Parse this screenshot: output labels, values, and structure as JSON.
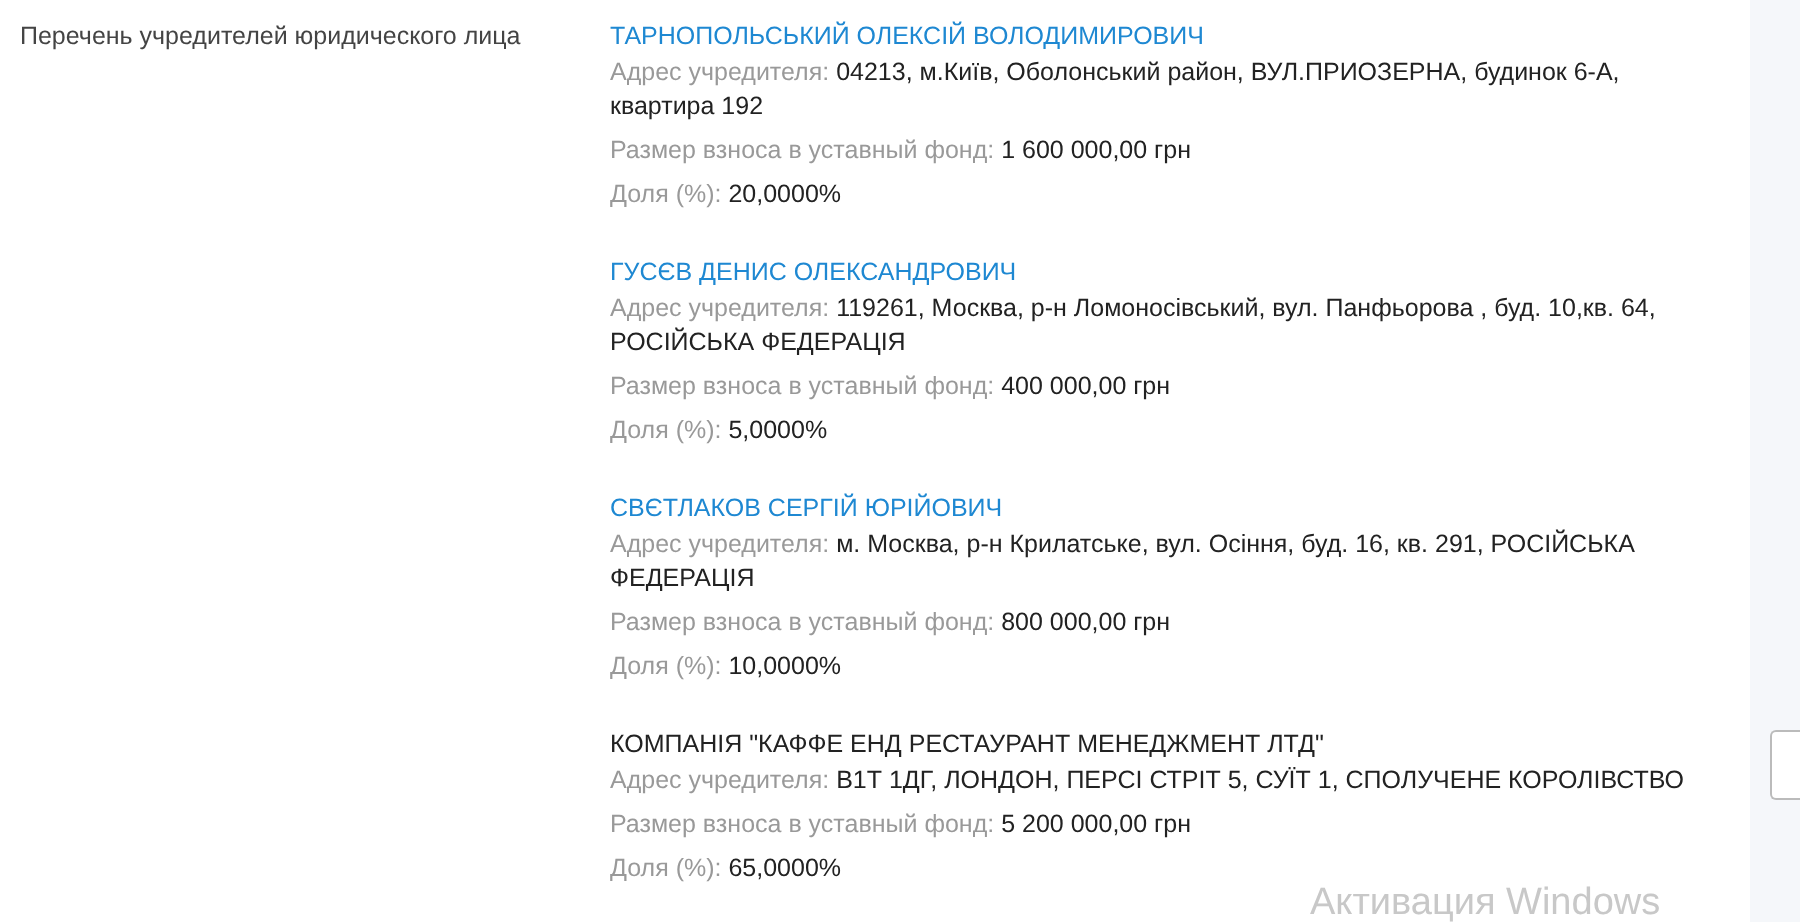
{
  "section_label": "Перечень учредителей юридического лица",
  "founders": [
    {
      "name": "ТАРНОПОЛЬСЬКИЙ ОЛЕКСІЙ ВОЛОДИМИРОВИЧ",
      "link": true,
      "address_label": "Адрес учредителя:",
      "address": "04213, м.Київ, Оболонський район, ВУЛ.ПРИОЗЕРНА, будинок 6-А, квартира 192",
      "contribution_label": "Размер взноса в уставный фонд:",
      "contribution": "1 600 000,00 грн",
      "share_label": "Доля (%):",
      "share": "20,0000%"
    },
    {
      "name": "ГУСЄВ ДЕНИС ОЛЕКСАНДРОВИЧ",
      "link": true,
      "address_label": "Адрес учредителя:",
      "address": "119261, Москва, р-н Ломоносівський, вул. Панфьорова , буд. 10,кв. 64, РОСІЙСЬКА ФЕДЕРАЦІЯ",
      "contribution_label": "Размер взноса в уставный фонд:",
      "contribution": "400 000,00 грн",
      "share_label": "Доля (%):",
      "share": "5,0000%"
    },
    {
      "name": "СВЄТЛАКОВ СЕРГІЙ ЮРІЙОВИЧ",
      "link": true,
      "address_label": "Адрес учредителя:",
      "address": "м. Москва, р-н Крилатське, вул. Осіння, буд. 16, кв. 291, РОСІЙСЬКА ФЕДЕРАЦІЯ",
      "contribution_label": "Размер взноса в уставный фонд:",
      "contribution": "800 000,00 грн",
      "share_label": "Доля (%):",
      "share": "10,0000%"
    },
    {
      "name": "КОМПАНІЯ \"КАФФЕ ЕНД РЕСТАУРАНТ МЕНЕДЖМЕНТ ЛТД\"",
      "link": false,
      "address_label": "Адрес учредителя:",
      "address": "В1Т 1ДГ, ЛОНДОН, ПЕРСІ СТРІТ 5, СУЇТ 1, СПОЛУЧЕНЕ КОРОЛІВСТВО",
      "contribution_label": "Размер взноса в уставный фонд:",
      "contribution": "5 200 000,00 грн",
      "share_label": "Доля (%):",
      "share": "65,0000%"
    }
  ],
  "os_notice": "Активация Windows"
}
